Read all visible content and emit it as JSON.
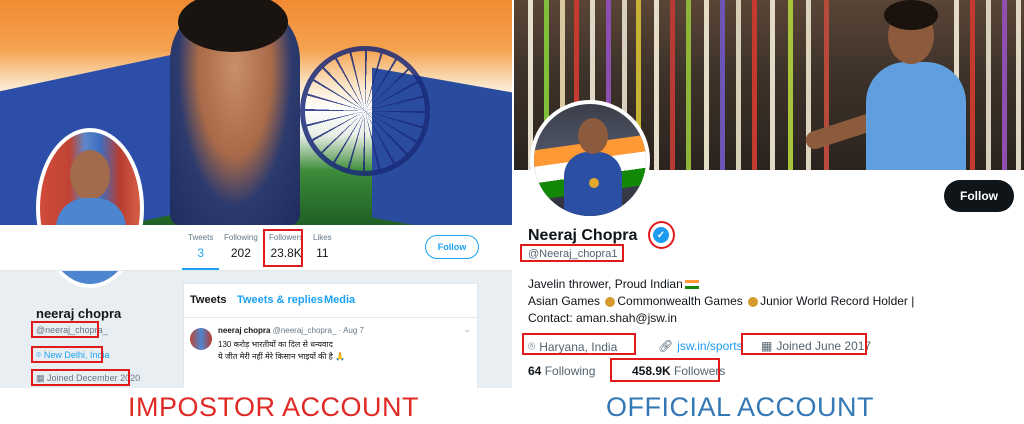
{
  "impostor": {
    "stats": [
      {
        "label": "Tweets",
        "value": "3"
      },
      {
        "label": "Following",
        "value": "202"
      },
      {
        "label": "Followers",
        "value": "23.8K"
      },
      {
        "label": "Likes",
        "value": "11"
      }
    ],
    "follow_label": "Follow",
    "name": "neeraj chopra",
    "handle": "@neeraj_chopra_",
    "location": "New Delhi, India",
    "joined": "Joined December 2020",
    "tabs": [
      "Tweets",
      "Tweets & replies",
      "Media"
    ],
    "tweet": {
      "author": "neeraj chopra",
      "handle_time": "@neeraj_chopra_ · Aug 7",
      "line1": "130 करोड़ भारतीयों का दिल से धन्यवाद",
      "line2": "ये जीत मेरी नहीं मेरे किसान भाइयों की है 🙏"
    }
  },
  "official": {
    "follow_label": "Follow",
    "name": "Neeraj Chopra",
    "verified_icon": "verified-badge-icon",
    "handle": "@Neeraj_chopra1",
    "bio_line1": "Javelin thrower, Proud Indian",
    "bio_line2_a": "Asian Games ",
    "bio_line2_b": "Commonwealth Games ",
    "bio_line2_c": "Junior World Record Holder |",
    "bio_line3": "Contact: aman.shah@jsw.in",
    "location": "Haryana, India",
    "link": "jsw.in/sports",
    "joined": "Joined June 2017",
    "following_count": "64",
    "following_label": "Following",
    "followers_count": "458.9K",
    "followers_label": "Followers"
  },
  "captions": {
    "impostor": "IMPOSTOR ACCOUNT",
    "official": "OFFICIAL ACCOUNT"
  },
  "colors": {
    "highlight": "#e01b1b",
    "impostor_caption": "#e02a26",
    "official_caption": "#3478b5",
    "twitter_blue": "#1da1f2"
  }
}
